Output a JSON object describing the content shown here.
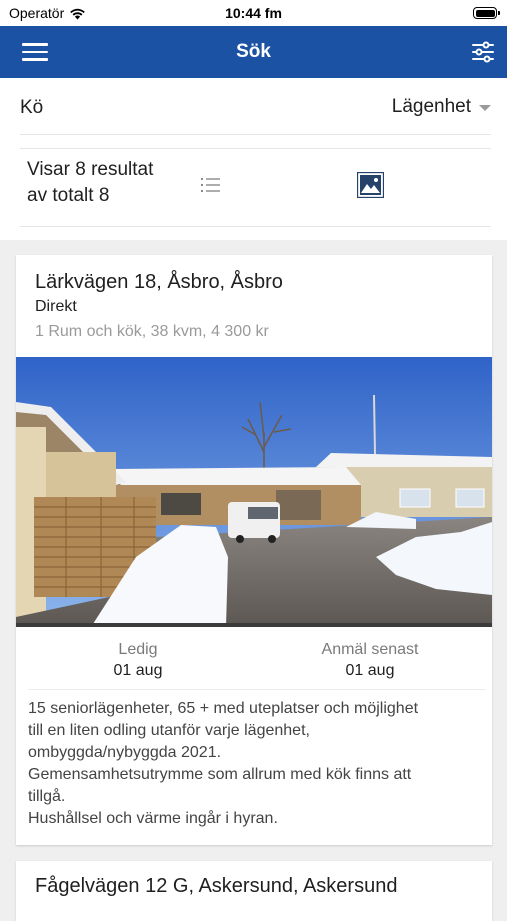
{
  "status_bar": {
    "carrier": "Operatör",
    "time": "10:44 fm",
    "wifi_icon": "wifi-icon",
    "battery_icon": "battery-icon"
  },
  "navbar": {
    "title": "Sök",
    "menu_icon": "hamburger-menu-icon",
    "filter_icon": "sliders-filter-icon",
    "color": "#1b52a3"
  },
  "filters": {
    "queue_label": "Kö",
    "type_selected": "Lägenhet"
  },
  "results": {
    "line1": "Visar 8 resultat",
    "line2": "av totalt 8",
    "list_view_icon": "list-view-icon",
    "image_view_icon": "image-view-icon"
  },
  "listings": [
    {
      "title": "Lärkvägen 18, Åsbro, Åsbro",
      "subtitle": "Direkt",
      "meta": "1 Rum och kök, 38 kvm, 4 300 kr",
      "available_label": "Ledig",
      "available_value": "01 aug",
      "deadline_label": "Anmäl senast",
      "deadline_value": "01 aug",
      "description": [
        "15 seniorlägenheter, 65 + med uteplatser och möjlighet",
        "till en liten odling utanför varje lägenhet,",
        "ombyggda/nybyggda 2021.",
        "Gemensamhetsutrymme som allrum med kök finns att",
        "tillgå.",
        "Hushållsel och värme ingår i hyran."
      ]
    },
    {
      "title": "Fågelvägen 12 G, Askersund, Askersund"
    }
  ]
}
